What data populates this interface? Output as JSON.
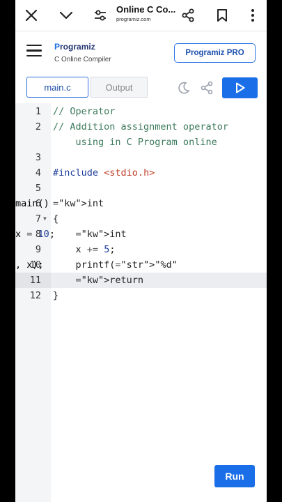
{
  "browser": {
    "title": "Online C Co...",
    "url": "programiz.com",
    "icons": [
      "close-icon",
      "chevron-down-icon",
      "tune-icon",
      "share-icon",
      "bookmark-icon",
      "more-vertical-icon"
    ]
  },
  "site": {
    "brand": "rogramiz",
    "brand_initial": "P",
    "subtitle": "C Online Compiler",
    "pro_button": "Programiz PRO"
  },
  "toolbar": {
    "tab_main": "main.c",
    "tab_output": "Output"
  },
  "editor": {
    "lines": [
      {
        "n": "1",
        "text": "// Operator"
      },
      {
        "n": "2",
        "text": "// Addition assignment operator"
      },
      {
        "n": "",
        "text": "    using in C Program online"
      },
      {
        "n": "3",
        "text": ""
      },
      {
        "n": "4",
        "text": "#include <stdio.h>"
      },
      {
        "n": "5",
        "text": ""
      },
      {
        "n": "6",
        "text": "int main()"
      },
      {
        "n": "7",
        "text": "{"
      },
      {
        "n": "8",
        "text": "    int x = 10;"
      },
      {
        "n": "9",
        "text": "    x += 5;"
      },
      {
        "n": "10",
        "text": "    printf(\"%d\", x);"
      },
      {
        "n": "11",
        "text": "    return 0;"
      },
      {
        "n": "12",
        "text": "}"
      }
    ],
    "active_line": "11"
  },
  "run_button": "Run",
  "colors": {
    "accent": "#1a6fe8",
    "brand": "#253873",
    "comment": "#3d7a5c",
    "keyword": "#1d3d9a",
    "string": "#c0402a"
  }
}
